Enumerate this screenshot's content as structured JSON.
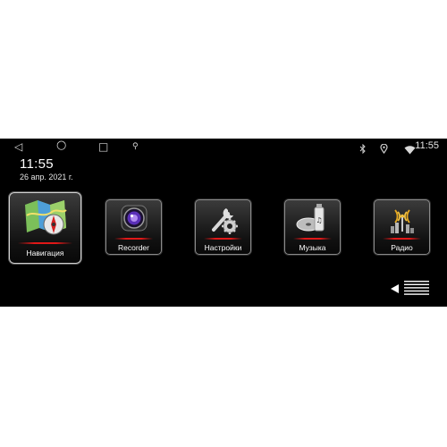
{
  "status_bar": {
    "time": "11:55",
    "nav_icons": [
      "back-icon",
      "home-icon",
      "recents-icon",
      "usb-icon"
    ],
    "status_icons": [
      "bluetooth-icon",
      "location-icon",
      "wifi-icon"
    ]
  },
  "home": {
    "clock": "11:55",
    "date": "26 апр. 2021 г."
  },
  "apps": [
    {
      "label": "Навигация",
      "icon": "navigation-map-icon",
      "selected": true
    },
    {
      "label": "Recorder",
      "icon": "camera-lens-icon"
    },
    {
      "label": "Настройки",
      "icon": "settings-tools-icon"
    },
    {
      "label": "Музыка",
      "icon": "music-usb-icon"
    },
    {
      "label": "Радио",
      "icon": "radio-antenna-icon"
    }
  ],
  "colors": {
    "accent": "#e01818",
    "background": "#000000"
  },
  "menu_button": {
    "icon": "all-apps-menu-icon"
  }
}
